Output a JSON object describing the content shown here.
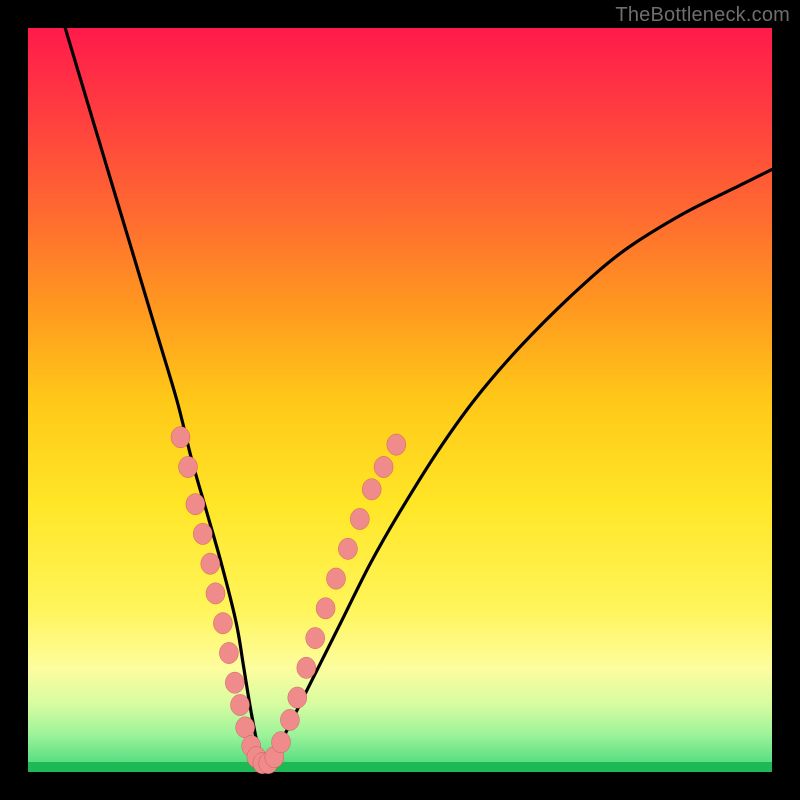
{
  "watermark": "TheBottleneck.com",
  "colors": {
    "background": "#000000",
    "gradient_top": "#ff1a4b",
    "gradient_bottom": "#41d67a",
    "curve": "#000000",
    "dot_fill": "#ef8b8b",
    "dot_stroke": "#c94e4e"
  },
  "chart_data": {
    "type": "line",
    "title": "",
    "xlabel": "",
    "ylabel": "",
    "xlim": [
      0,
      100
    ],
    "ylim": [
      0,
      100
    ],
    "grid": false,
    "legend": false,
    "series": [
      {
        "name": "bottleneck-curve",
        "x": [
          5,
          8,
          11,
          14,
          17,
          20,
          22,
          24,
          26,
          28,
          29,
          30,
          31,
          32,
          33,
          35,
          38,
          42,
          46,
          50,
          55,
          60,
          66,
          73,
          80,
          88,
          96,
          100
        ],
        "y": [
          100,
          90,
          80,
          70,
          60,
          50,
          42,
          35,
          28,
          20,
          14,
          8,
          3,
          0,
          2,
          6,
          12,
          20,
          28,
          35,
          43,
          50,
          57,
          64,
          70,
          75,
          79,
          81
        ]
      }
    ],
    "markers": {
      "name": "highlight-dots",
      "note": "points along curve near the valley, read approximately from the image",
      "points": [
        {
          "x": 20.5,
          "y": 45
        },
        {
          "x": 21.5,
          "y": 41
        },
        {
          "x": 22.5,
          "y": 36
        },
        {
          "x": 23.5,
          "y": 32
        },
        {
          "x": 24.5,
          "y": 28
        },
        {
          "x": 25.2,
          "y": 24
        },
        {
          "x": 26.2,
          "y": 20
        },
        {
          "x": 27.0,
          "y": 16
        },
        {
          "x": 27.8,
          "y": 12
        },
        {
          "x": 28.5,
          "y": 9
        },
        {
          "x": 29.2,
          "y": 6
        },
        {
          "x": 30.0,
          "y": 3.5
        },
        {
          "x": 30.7,
          "y": 2
        },
        {
          "x": 31.5,
          "y": 1.2
        },
        {
          "x": 32.3,
          "y": 1.2
        },
        {
          "x": 33.1,
          "y": 2
        },
        {
          "x": 34.0,
          "y": 4
        },
        {
          "x": 35.2,
          "y": 7
        },
        {
          "x": 36.2,
          "y": 10
        },
        {
          "x": 37.4,
          "y": 14
        },
        {
          "x": 38.6,
          "y": 18
        },
        {
          "x": 40.0,
          "y": 22
        },
        {
          "x": 41.4,
          "y": 26
        },
        {
          "x": 43.0,
          "y": 30
        },
        {
          "x": 44.6,
          "y": 34
        },
        {
          "x": 46.2,
          "y": 38
        },
        {
          "x": 47.8,
          "y": 41
        },
        {
          "x": 49.5,
          "y": 44
        }
      ]
    }
  }
}
